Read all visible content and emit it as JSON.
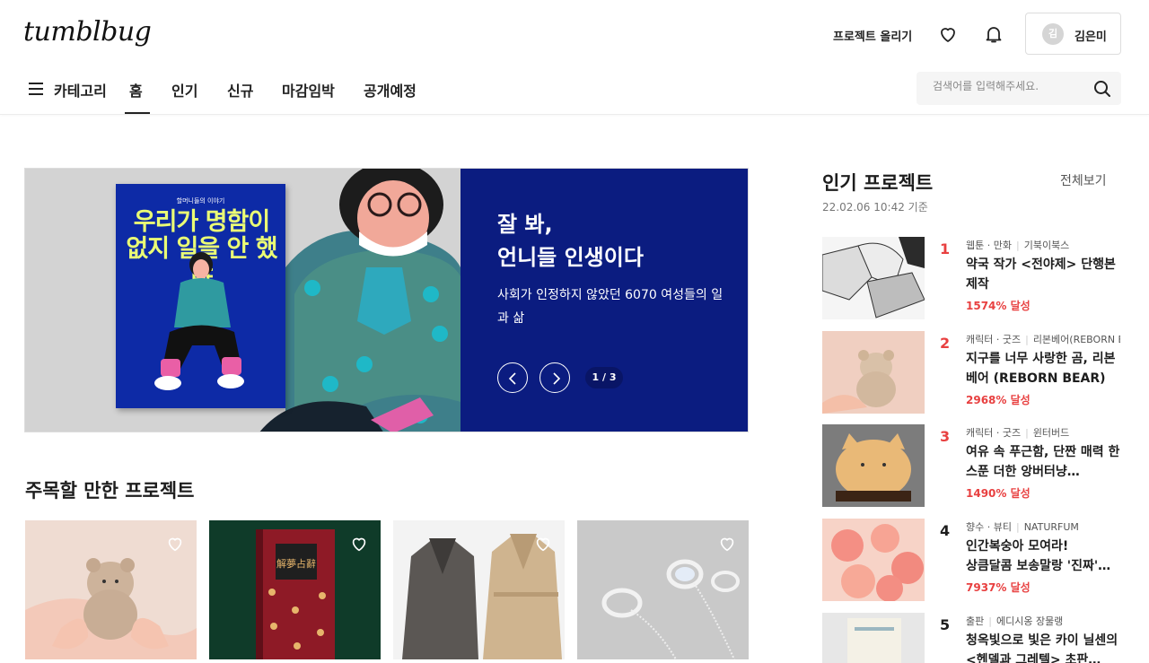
{
  "header": {
    "logo": "tumblbug",
    "upload_label": "프로젝트 올리기",
    "user": {
      "avatar_initial": "김",
      "name": "김은미"
    }
  },
  "nav": {
    "category_label": "카테고리",
    "items": [
      {
        "label": "홈",
        "active": true
      },
      {
        "label": "인기"
      },
      {
        "label": "신규"
      },
      {
        "label": "마감임박"
      },
      {
        "label": "공개예정"
      }
    ]
  },
  "search": {
    "placeholder": "검색어를 입력해주세요.",
    "value": ""
  },
  "banner": {
    "title_line1": "잘 봐,",
    "title_line2": "언니들 인생이다",
    "description": "사회가 인정하지 않았던 6070 여성들의 일과 삶",
    "counter": "1 / 3",
    "book": {
      "top_text": "할머니들의 이야기",
      "title": "우리가 명함이 없지 일을 안 했냐"
    }
  },
  "featured": {
    "title": "주목할 만한 프로젝트",
    "cards": [
      {
        "image": "plush-bear-in-hands-photo"
      },
      {
        "image": "red-book-cover-photo",
        "book_text": "解夢占辭"
      },
      {
        "image": "trench-coats-photo"
      },
      {
        "image": "silver-turtle-necklaces-photo"
      }
    ]
  },
  "popular": {
    "title": "인기 프로젝트",
    "more_label": "전체보기",
    "date": "22.02.06 10:42 기준",
    "items": [
      {
        "rank": "1",
        "category": "웹툰 · 만화",
        "creator": "기북이북스",
        "name": "약국 작가 <전야제> 단행본 제작",
        "rate": "1574% 달성",
        "rank_color": "#e84040"
      },
      {
        "rank": "2",
        "category": "캐릭터 · 굿즈",
        "creator": "리본베어(REBORN BEAR)",
        "name": "지구를 너무 사랑한 곰, 리본베어 (REBORN BEAR)",
        "rate": "2968% 달성",
        "rank_color": "#e84040"
      },
      {
        "rank": "3",
        "category": "캐릭터 · 굿즈",
        "creator": "윈터버드",
        "name": "여유 속 푸근함, 단짠 매력 한스푼 더한 앙버터냥…",
        "rate": "1490% 달성",
        "rank_color": "#e84040"
      },
      {
        "rank": "4",
        "category": "향수 · 뷰티",
        "creator": "NATURFUM",
        "name": "인간복숭아 모여라!\n상큼달콤 보송말랑 '진짜'…",
        "rate": "7937% 달성",
        "rank_color": "#1d1d1d"
      },
      {
        "rank": "5",
        "category": "출판",
        "creator": "에디시옹 장물랭",
        "name": "청옥빛으로 빛은 카이 닐센의 <헨델과 그레텔> 초판…",
        "rate": "",
        "rank_color": "#1d1d1d"
      }
    ]
  }
}
